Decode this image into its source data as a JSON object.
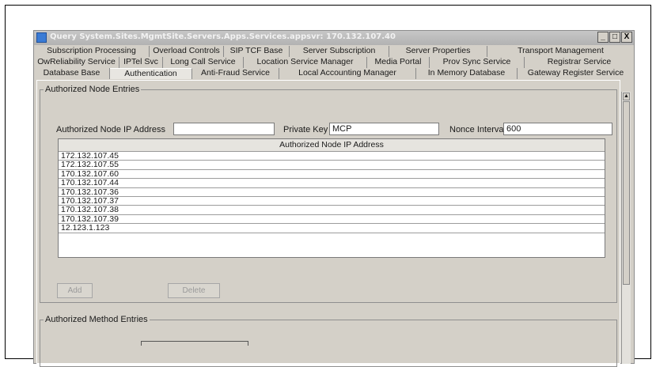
{
  "window": {
    "title": "Query System.Sites.MgmtSite.Servers.Apps.Services.appsvr: 170.132.107.40",
    "controls": [
      "_",
      "□",
      "X"
    ]
  },
  "tabs": {
    "row1": [
      "Subscription Processing",
      "Overload Controls",
      "SIP TCF Base",
      "Server Subscription",
      "Server Properties",
      "Transport Management"
    ],
    "row2": [
      "OwReliability Service",
      "IPTel Svc",
      "Long Call Service",
      "Location Service Manager",
      "Media Portal",
      "Prov Sync Service",
      "Registrar Service"
    ],
    "row3": [
      "Database Base",
      "Authentication",
      "Anti-Fraud Service",
      "Local Accounting Manager",
      "In Memory Database",
      "Gateway Register Service"
    ],
    "active": "Authentication"
  },
  "authorized_node": {
    "legend": "Authorized Node Entries",
    "ip_label": "Authorized Node IP Address",
    "ip_value": "",
    "key_label": "Private Key",
    "key_value": "MCP",
    "nonce_label": "Nonce Interval",
    "nonce_value": "600",
    "table_header": "Authorized Node IP Address",
    "rows": [
      "172.132.107.45",
      "172.132.107.55",
      "170.132.107.60",
      "170.132.107.44",
      "170.132.107.36",
      "170.132.107.37",
      "170.132.107.38",
      "170.132.107.39",
      "12.123.1.123"
    ],
    "add_label": "Add",
    "delete_label": "Delete"
  },
  "authorized_method": {
    "legend": "Authorized Method Entries"
  }
}
